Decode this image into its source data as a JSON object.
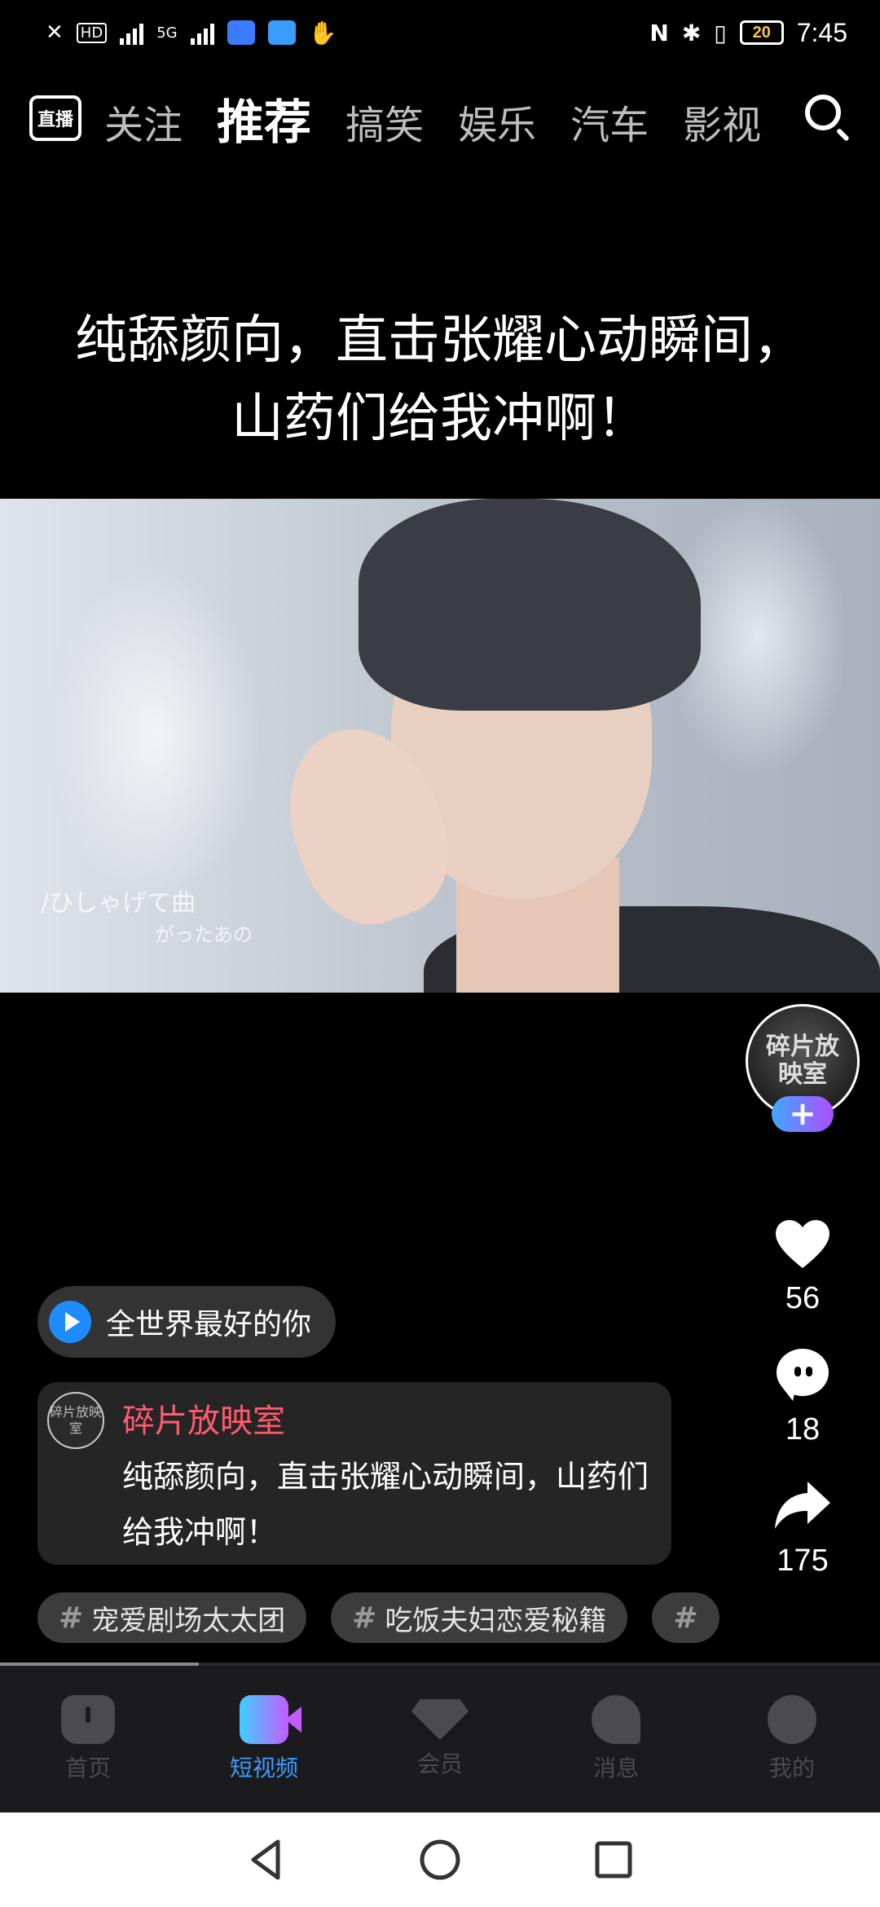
{
  "status_bar": {
    "time": "7:45",
    "battery": "20",
    "hd_label": "HD",
    "network": "5G"
  },
  "top_nav": {
    "live_label": "直播",
    "tabs": [
      "关注",
      "推荐",
      "搞笑",
      "娱乐",
      "汽车",
      "影视"
    ],
    "active_tab": "推荐"
  },
  "video": {
    "caption": "纯舔颜向，直击张耀心动瞬间，山药们给我冲啊！",
    "watermark_line1": "/ひしゃげて曲",
    "watermark_line2": "がったあの"
  },
  "rail": {
    "author_logo_text": "碎片放映室",
    "follow_label": "+",
    "likes": "56",
    "comments": "18",
    "shares": "175"
  },
  "music": {
    "title": "全世界最好的你"
  },
  "description": {
    "author": "碎片放映室",
    "text": "纯舔颜向，直击张耀心动瞬间，山药们给我冲啊！"
  },
  "hashtags": [
    "宠爱剧场太太团",
    "吃饭夫妇恋爱秘籍",
    "#"
  ],
  "playback_progress": 0.226,
  "bottom_nav": {
    "items": [
      {
        "label": "首页",
        "icon": "home-icon"
      },
      {
        "label": "短视频",
        "icon": "video-icon"
      },
      {
        "label": "会员",
        "icon": "vip-icon"
      },
      {
        "label": "消息",
        "icon": "message-icon"
      },
      {
        "label": "我的",
        "icon": "profile-icon"
      }
    ],
    "active_index": 1
  },
  "colors": {
    "accent_blue": "#3d9bff",
    "author_pink": "#ff5a6e",
    "follow_gradient_start": "#3fa8ff",
    "follow_gradient_end": "#b04dff"
  }
}
